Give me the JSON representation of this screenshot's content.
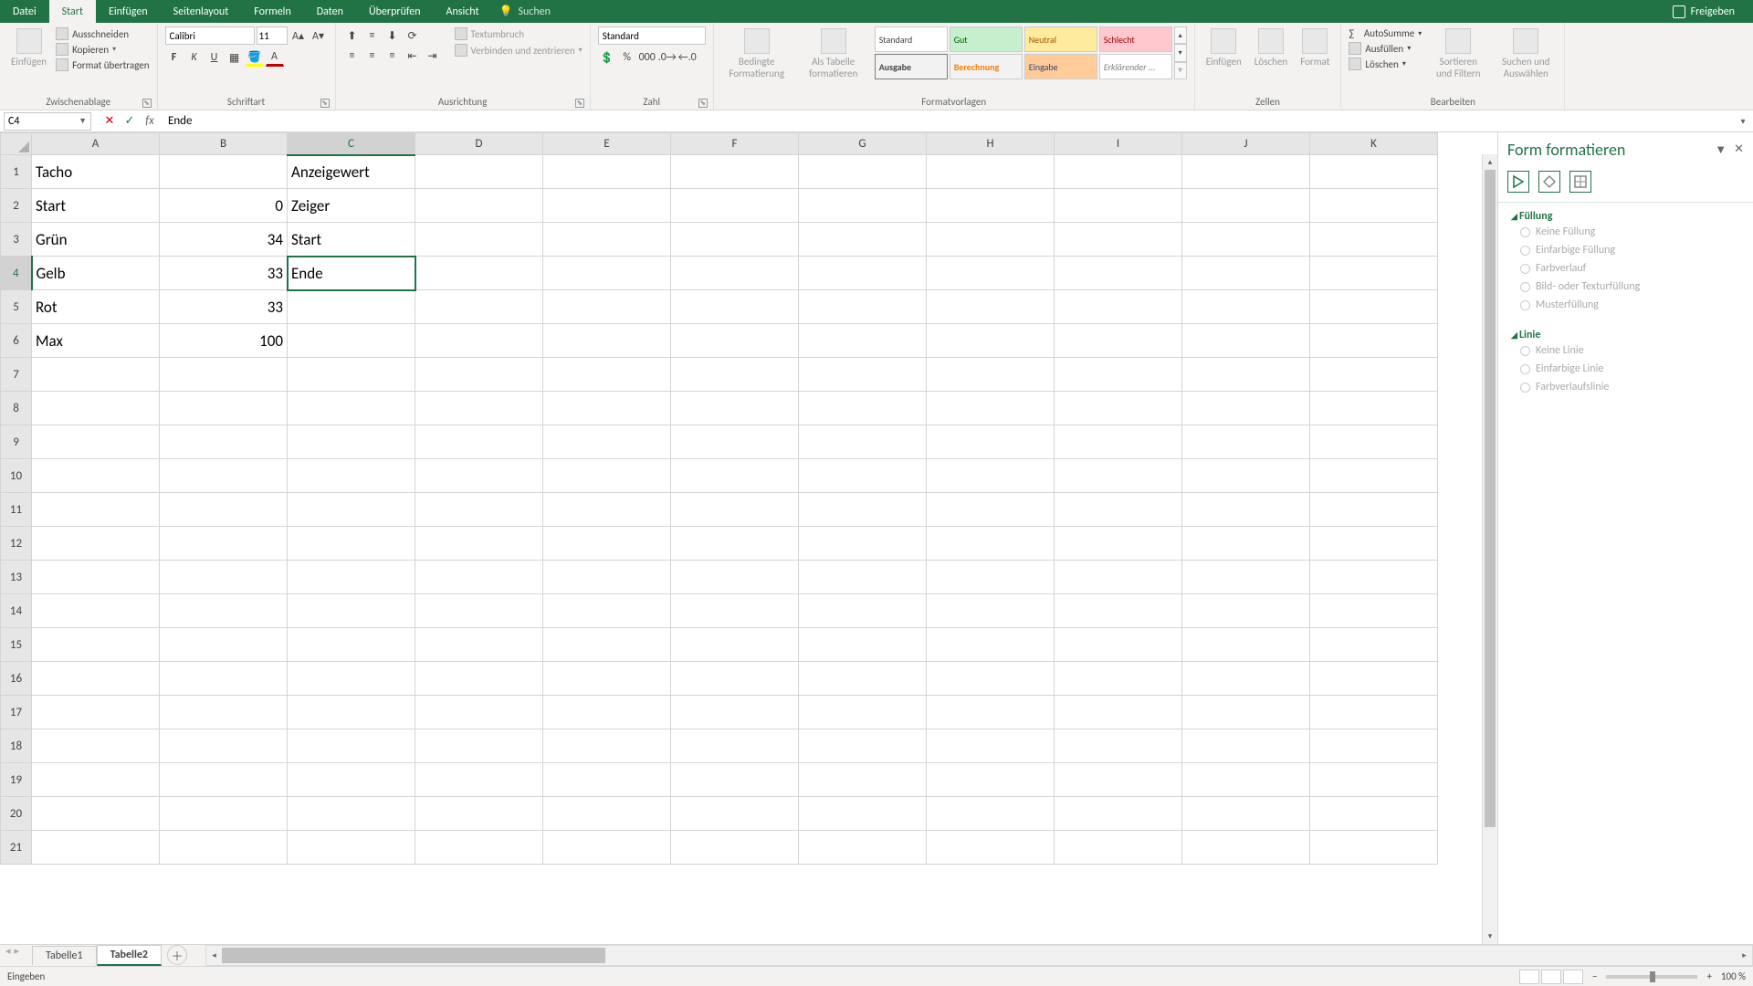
{
  "titlebar": {
    "tabs": [
      "Datei",
      "Start",
      "Einfügen",
      "Seitenlayout",
      "Formeln",
      "Daten",
      "Überprüfen",
      "Ansicht"
    ],
    "active_tab": 1,
    "search_label": "Suchen",
    "share_label": "Freigeben"
  },
  "ribbon": {
    "clipboard": {
      "paste_label": "Einfügen",
      "cut": "Ausschneiden",
      "copy": "Kopieren",
      "format_painter": "Format übertragen",
      "group_label": "Zwischenablage"
    },
    "font": {
      "name": "Calibri",
      "size": "11",
      "group_label": "Schriftart"
    },
    "alignment": {
      "wrap": "Textumbruch",
      "merge": "Verbinden und zentrieren",
      "group_label": "Ausrichtung"
    },
    "number": {
      "format": "Standard",
      "group_label": "Zahl"
    },
    "styles": {
      "cond_fmt": "Bedingte Formatierung",
      "as_table": "Als Tabelle formatieren",
      "gallery": [
        "Standard",
        "Gut",
        "Neutral",
        "Schlecht",
        "Ausgabe",
        "Berechnung",
        "Eingabe",
        "Erklärender ..."
      ],
      "group_label": "Formatvorlagen"
    },
    "cells": {
      "insert": "Einfügen",
      "delete": "Löschen",
      "format": "Format",
      "group_label": "Zellen"
    },
    "editing": {
      "autosum": "AutoSumme",
      "fill": "Ausfüllen",
      "clear": "Löschen",
      "sort": "Sortieren und Filtern",
      "find": "Suchen und Auswählen",
      "group_label": "Bearbeiten"
    }
  },
  "namebox": "C4",
  "formula_value": "Ende",
  "columns": [
    "A",
    "B",
    "C",
    "D",
    "E",
    "F",
    "G",
    "H",
    "I",
    "J",
    "K"
  ],
  "row_count": 21,
  "active_cell": {
    "col": "C",
    "row": 4
  },
  "cells": {
    "A1": "Tacho",
    "C1": "Anzeigewert",
    "A2": "Start",
    "B2": "0",
    "C2": "Zeiger",
    "A3": "Grün",
    "B3": "34",
    "C3": "Start",
    "A4": "Gelb",
    "B4": "33",
    "C4": "Ende",
    "A5": "Rot",
    "B5": "33",
    "A6": "Max",
    "B6": "100"
  },
  "numeric_cells": [
    "B2",
    "B3",
    "B4",
    "B5",
    "B6"
  ],
  "task_pane": {
    "title": "Form formatieren",
    "sections": {
      "fill": {
        "title": "Füllung",
        "options": [
          "Keine Füllung",
          "Einfarbige Füllung",
          "Farbverlauf",
          "Bild- oder Texturfüllung",
          "Musterfüllung"
        ]
      },
      "line": {
        "title": "Linie",
        "options": [
          "Keine Linie",
          "Einfarbige Linie",
          "Farbverlaufslinie"
        ]
      }
    }
  },
  "sheet_tabs": {
    "tabs": [
      "Tabelle1",
      "Tabelle2"
    ],
    "active": 1
  },
  "status": {
    "mode": "Eingeben",
    "zoom": "100 %"
  }
}
